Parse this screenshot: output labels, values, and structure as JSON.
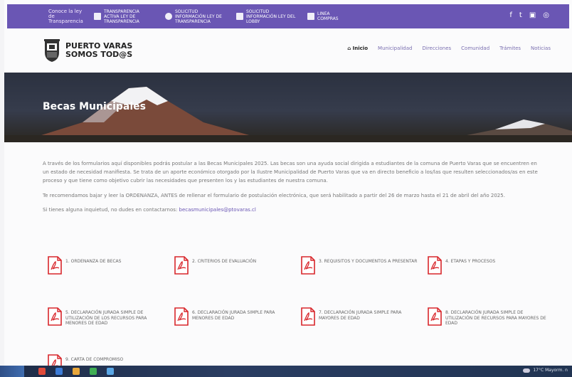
{
  "topbar": {
    "links": [
      {
        "label": "Conoce la ley de Transparencia",
        "icon": "transparency-icon"
      },
      {
        "label": "TRANSPARENCIA ACTIVA LEY DE TRANSPARENCIA",
        "icon": "document-icon"
      },
      {
        "label": "SOLICITUD INFORMACIÓN LEY DE TRANSPARENCIA",
        "icon": "info-icon"
      },
      {
        "label": "SOLICITUD INFORMACIÓN LEY DEL LOBBY",
        "icon": "building-icon"
      },
      {
        "label": "LINEA COMPRAS",
        "icon": "cart-icon"
      }
    ],
    "social": [
      "f",
      "t",
      "▣",
      "◎"
    ]
  },
  "header": {
    "logo_line1": "PUERTO VARAS",
    "logo_line2": "SOMOS TOD@S",
    "nav": [
      "Inicio",
      "Municipalidad",
      "Direcciones",
      "Comunidad",
      "Trámites",
      "Noticias"
    ]
  },
  "banner": {
    "title": "Becas Municipales"
  },
  "content": {
    "p1": "A través de los formularios aquí disponibles podrás postular a las Becas Municipales 2025. Las becas son una ayuda social dirigida a estudiantes de la comuna de Puerto Varas que se encuentren en un estado de necesidad manifiesta. Se trata de un aporte económico otorgado por la Ilustre Municipalidad de Puerto Varas que va en directo beneficio a los/las que resulten seleccionados/as en este proceso y que tiene como objetivo cubrir las necesidades que presenten los y las estudiantes de nuestra comuna.",
    "p2": "Te recomendamos bajar y leer la ORDENANZA, ANTES de rellenar el formulario de postulación electrónica, que será habilitado a partir del 26 de marzo hasta el 21 de abril del año 2025.",
    "p3_text": "Si tienes alguna inquietud, no dudes en contactarnos:",
    "p3_email": "becasmunicipales@ptovaras.cl"
  },
  "documents": [
    "1. ORDENANZA DE BECAS",
    "2. CRITERIOS DE EVALUACIÓN",
    "3. REQUISITOS Y DOCUMENTOS A PRESENTAR",
    "4. ETAPAS Y PROCESOS",
    "5. DECLARACIÓN JURADA SIMPLE DE UTILIZACIÓN DE LOS RECURSOS PARA MENORES DE EDAD",
    "6. DECLARACIÓN JURADA SIMPLE PARA MENORES DE EDAD",
    "7. DECLARACIÓN JURADA SIMPLE PARA MAYORES DE EDAD",
    "8. DECLARACIÓN JURADA SIMPLE DE UTILIZACIÓN DE RECURSOS PARA MAYORES DE EDAD",
    "9. CARTA DE COMPROMISO"
  ],
  "taskbar": {
    "weather": "17°C Mayorm. n"
  },
  "colors": {
    "accent": "#6a56b4",
    "pdf": "#d8262b"
  }
}
